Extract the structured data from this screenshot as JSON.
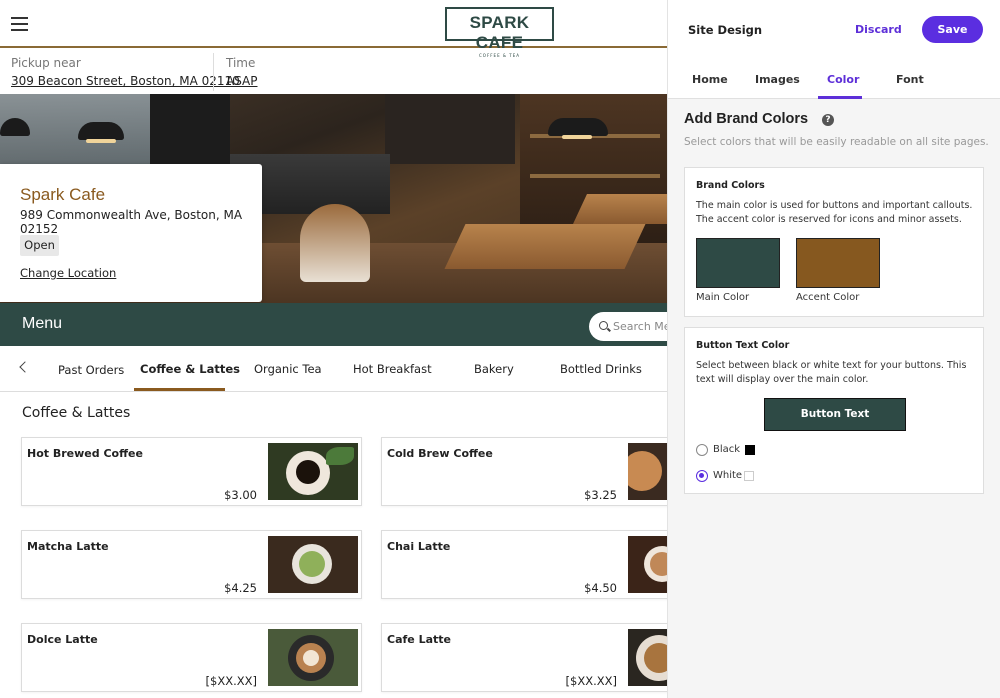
{
  "site": {
    "logo": {
      "name": "SPARK CAFE",
      "tagline": "COFFEE & TEA"
    },
    "pickup": {
      "label": "Pickup near",
      "address": "309 Beacon Street, Boston, MA 02110"
    },
    "time": {
      "label": "Time",
      "value": "ASAP"
    },
    "location_card": {
      "name": "Spark Cafe",
      "address": "989 Commonwealth Ave, Boston, MA 02152",
      "status": "Open",
      "change_link": "Change Location"
    },
    "menu": {
      "title": "Menu",
      "search_placeholder": "Search Menu"
    },
    "categories": [
      {
        "label": "Past Orders",
        "active": false
      },
      {
        "label": "Coffee & Lattes",
        "active": true
      },
      {
        "label": "Organic Tea",
        "active": false
      },
      {
        "label": "Hot Breakfast",
        "active": false
      },
      {
        "label": "Bakery",
        "active": false
      },
      {
        "label": "Bottled Drinks",
        "active": false
      }
    ],
    "section_title": "Coffee & Lattes",
    "items": [
      {
        "name": "Hot Brewed Coffee",
        "price": "$3.00"
      },
      {
        "name": "Cold Brew Coffee",
        "price": "$3.25"
      },
      {
        "name": "Matcha Latte",
        "price": "$4.25"
      },
      {
        "name": "Chai Latte",
        "price": "$4.50"
      },
      {
        "name": "Dolce Latte",
        "price": "[$XX.XX]"
      },
      {
        "name": "Cafe Latte",
        "price": "[$XX.XX]"
      }
    ]
  },
  "panel": {
    "title": "Site Design",
    "discard": "Discard",
    "save": "Save",
    "tabs": [
      {
        "label": "Home",
        "active": false
      },
      {
        "label": "Images",
        "active": false
      },
      {
        "label": "Color",
        "active": true
      },
      {
        "label": "Font",
        "active": false
      }
    ],
    "heading": "Add Brand Colors",
    "subheading": "Select colors that will be easily readable on all site pages.",
    "brand_colors": {
      "title": "Brand Colors",
      "description": "The main color is used for buttons and important callouts. The accent color is reserved for icons and minor assets.",
      "main": {
        "label": "Main Color",
        "color": "#2e4a45"
      },
      "accent": {
        "label": "Accent Color",
        "color": "#86581f"
      }
    },
    "button_text": {
      "title": "Button Text Color",
      "description": "Select between black or white text for your buttons. This text will display over the main color.",
      "preview": "Button Text",
      "options": [
        {
          "label": "Black",
          "selected": false,
          "color": "#000000"
        },
        {
          "label": "White",
          "selected": true,
          "color": "#ffffff"
        }
      ]
    }
  },
  "colors": {
    "accent_ui": "#5b2ee0",
    "brand_main": "#2e4a45",
    "brand_accent": "#86581f"
  }
}
